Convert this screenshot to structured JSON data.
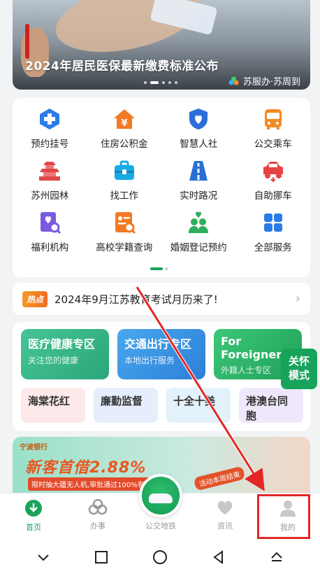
{
  "banner": {
    "title": "2024年居民医保最新缴费标准公布",
    "brand": "苏服办·苏周到"
  },
  "services": [
    {
      "label": "预约挂号",
      "icon": "hospital-cross-icon"
    },
    {
      "label": "住房公积金",
      "icon": "house-yuan-icon"
    },
    {
      "label": "智慧人社",
      "icon": "shield-heart-icon"
    },
    {
      "label": "公交乘车",
      "icon": "bus-icon"
    },
    {
      "label": "苏州园林",
      "icon": "pagoda-icon"
    },
    {
      "label": "找工作",
      "icon": "briefcase-icon"
    },
    {
      "label": "实时路况",
      "icon": "road-icon"
    },
    {
      "label": "自助挪车",
      "icon": "car-icon"
    },
    {
      "label": "福利机构",
      "icon": "welfare-search-icon"
    },
    {
      "label": "高校学籍查询",
      "icon": "student-card-icon"
    },
    {
      "label": "婚姻登记预约",
      "icon": "couple-heart-icon"
    },
    {
      "label": "全部服务",
      "icon": "grid-icon"
    }
  ],
  "hot": {
    "tag": "热点",
    "text": "2024年9月江苏教育考试月历来了!"
  },
  "zones": {
    "medical": {
      "title": "医疗健康专区",
      "sub": "关注您的健康"
    },
    "traffic": {
      "title": "交通出行专区",
      "sub": "本地出行服务"
    },
    "foreigner": {
      "title": "For Foreigners",
      "sub": "外籍人士专区"
    },
    "mini": [
      "海棠花红",
      "廉勤监督",
      "十全十美",
      "港澳台同胞"
    ]
  },
  "care_mode": "关怀\n模式",
  "ad": {
    "bank": "宁波银行",
    "headline": "新客首借2.88%",
    "sub": "限时抽大疆无人机,审批通过100%有礼",
    "promo": "活动本周结束"
  },
  "nav": [
    {
      "label": "首页",
      "icon": "home-download-icon",
      "active": true
    },
    {
      "label": "办事",
      "icon": "services-logo-icon",
      "active": false
    },
    {
      "label": "公交地铁",
      "icon": "train-icon",
      "active": false
    },
    {
      "label": "资讯",
      "icon": "heart-icon",
      "active": false
    },
    {
      "label": "我的",
      "icon": "person-icon",
      "active": false
    }
  ],
  "colors": {
    "brand_green": "#1aa35a",
    "highlight_red": "#e32626"
  }
}
